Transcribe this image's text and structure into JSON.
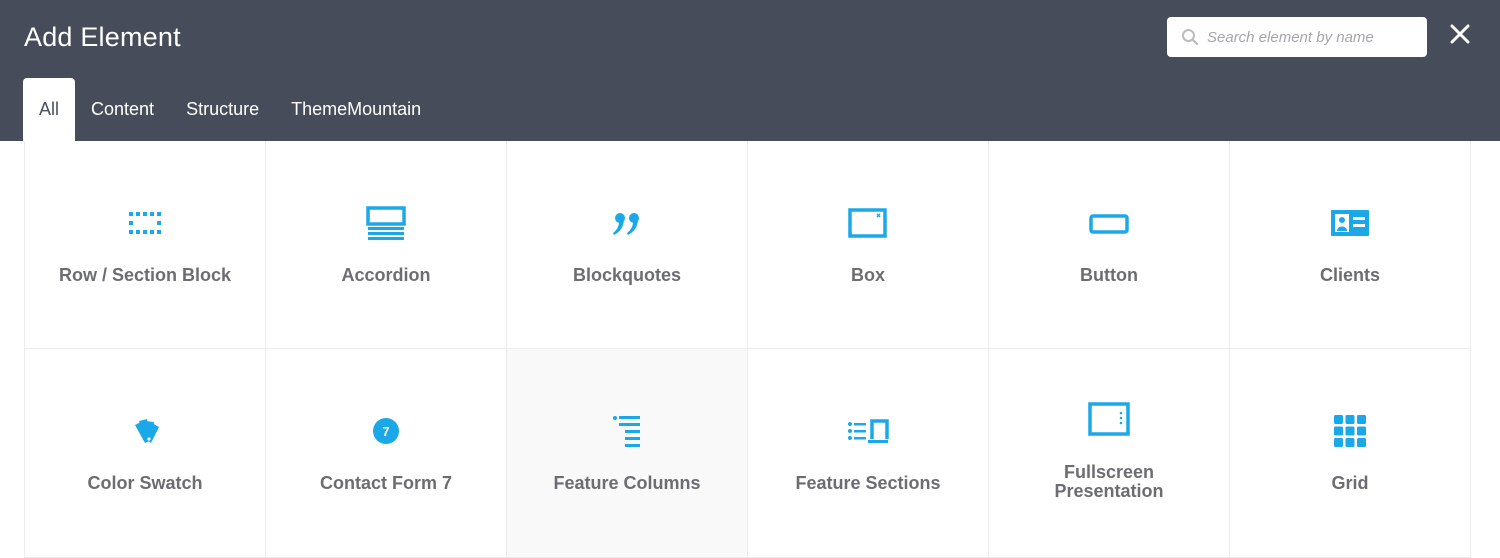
{
  "header": {
    "title": "Add Element",
    "search": {
      "placeholder": "Search element by name",
      "value": ""
    },
    "close_icon": "close-icon"
  },
  "tabs": [
    {
      "label": "All",
      "active": true
    },
    {
      "label": "Content",
      "active": false
    },
    {
      "label": "Structure",
      "active": false
    },
    {
      "label": "ThemeMountain",
      "active": false
    }
  ],
  "elements": [
    {
      "label": "Row / Section Block",
      "icon": "row-section-icon"
    },
    {
      "label": "Accordion",
      "icon": "accordion-icon"
    },
    {
      "label": "Blockquotes",
      "icon": "quote-icon"
    },
    {
      "label": "Box",
      "icon": "box-icon"
    },
    {
      "label": "Button",
      "icon": "button-icon"
    },
    {
      "label": "Clients",
      "icon": "clients-icon"
    },
    {
      "label": "Color Swatch",
      "icon": "color-swatch-icon"
    },
    {
      "label": "Contact Form 7",
      "icon": "contact-form-icon",
      "badge": "7"
    },
    {
      "label": "Feature Columns",
      "icon": "feature-columns-icon"
    },
    {
      "label": "Feature Sections",
      "icon": "feature-sections-icon"
    },
    {
      "label": "Fullscreen Presentation",
      "icon": "fullscreen-presentation-icon"
    },
    {
      "label": "Grid",
      "icon": "grid-icon"
    }
  ],
  "colors": {
    "header_bg": "#474c5a",
    "accent": "#1ba8e8",
    "label": "#6b6d72"
  }
}
